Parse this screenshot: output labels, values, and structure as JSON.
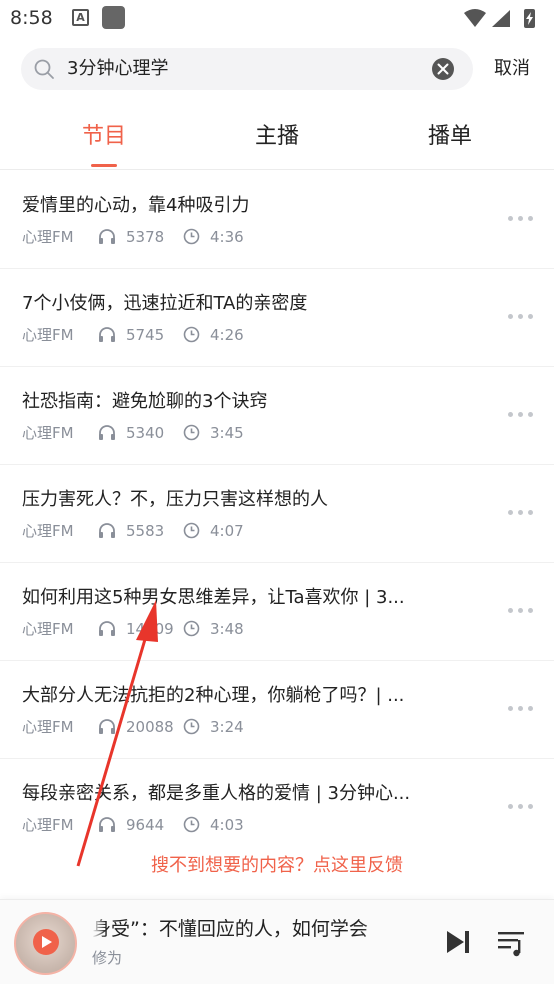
{
  "status_bar": {
    "time": "8:58",
    "notification_letter": "A",
    "icons": [
      "wifi-icon",
      "signal-icon",
      "battery-charging-icon"
    ]
  },
  "search": {
    "value": "3分钟心理学",
    "cancel_label": "取消"
  },
  "tabs": [
    {
      "label": "节目",
      "active": true
    },
    {
      "label": "主播",
      "active": false
    },
    {
      "label": "播单",
      "active": false
    }
  ],
  "programs": [
    {
      "title": "爱情里的心动，靠4种吸引力",
      "source": "心理FM",
      "plays": "5378",
      "duration": "4:36"
    },
    {
      "title": "7个小伎俩，迅速拉近和TA的亲密度",
      "source": "心理FM",
      "plays": "5745",
      "duration": "4:26"
    },
    {
      "title": "社恐指南：避免尬聊的3个诀窍",
      "source": "心理FM",
      "plays": "5340",
      "duration": "3:45"
    },
    {
      "title": "压力害死人？不，压力只害这样想的人",
      "source": "心理FM",
      "plays": "5583",
      "duration": "4:07"
    },
    {
      "title": "如何利用这5种男女思维差异，让Ta喜欢你 | 3...",
      "source": "心理FM",
      "plays": "14609",
      "duration": "3:48"
    },
    {
      "title": "大部分人无法抗拒的2种心理，你躺枪了吗？| ...",
      "source": "心理FM",
      "plays": "20088",
      "duration": "3:24"
    },
    {
      "title": "每段亲密关系，都是多重人格的爱情 | 3分钟心...",
      "source": "心理FM",
      "plays": "9644",
      "duration": "4:03"
    }
  ],
  "feedback_text": "搜不到想要的内容？点这里反馈",
  "player": {
    "title": "身受”：不懂回应的人，如何学会",
    "artist": "修为"
  },
  "colors": {
    "accent": "#f0624a",
    "meta": "#8a8f99",
    "annotation_arrow": "#e8352b"
  }
}
